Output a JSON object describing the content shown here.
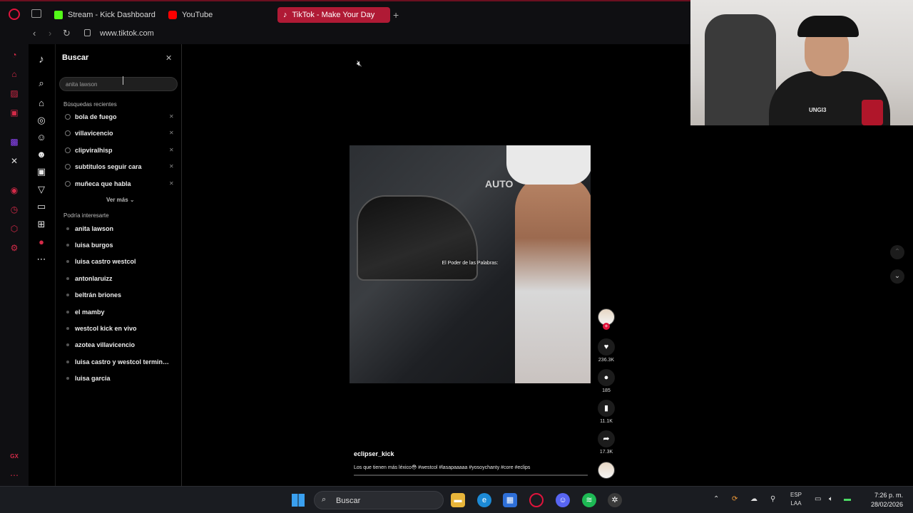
{
  "browser": {
    "tabs": [
      {
        "label": "Stream - Kick Dashboard",
        "icon": "kick-icon",
        "color": "#53fc18"
      },
      {
        "label": "YouTube",
        "icon": "youtube-icon",
        "color": "#ff0000"
      },
      {
        "label": "TikTok - Make Your Day",
        "icon": "tiktok-icon",
        "color": "#ffffff",
        "active": true
      }
    ],
    "url": "www.tiktok.com"
  },
  "search_panel": {
    "title": "Buscar",
    "query": "anita lawson",
    "recent_header": "Búsquedas recientes",
    "recent": [
      "bola de fuego",
      "villavicencio",
      "clipviralhisp",
      "subtitulos seguir cara",
      "muñeca que habla"
    ],
    "see_more": "Ver más ⌄",
    "suggest_header": "Podría interesarte",
    "suggestions": [
      "anita lawson",
      "luisa burgos",
      "luisa castro westcol",
      "antonlaruizz",
      "beltrán briones",
      "el mamby",
      "westcol kick en vivo",
      "azotea villavicencio",
      "luisa castro y westcol terminar...",
      "luisa garcia"
    ]
  },
  "video": {
    "sign_text": "AUTO",
    "subtitle": "El Poder de las Palabras:",
    "author": "eclipser_kick",
    "description": "Los que tienen más léxico😳 #westcol #lasapaaaaa #yosoychanty #core #eclips",
    "likes": "236.3K",
    "comments": "185",
    "saves": "11.1K",
    "shares": "17.3K",
    "progress": 0
  },
  "webcam": {
    "shirt_logo": "UNGI3"
  },
  "taskbar": {
    "search_label": "Buscar",
    "lang_1": "ESP",
    "lang_2": "LAA",
    "time": "7:26 p. m.",
    "date": "28/02/2026"
  },
  "colors": {
    "accent": "#e0143c",
    "tab_active": "#b01a35",
    "background": "#000000"
  }
}
